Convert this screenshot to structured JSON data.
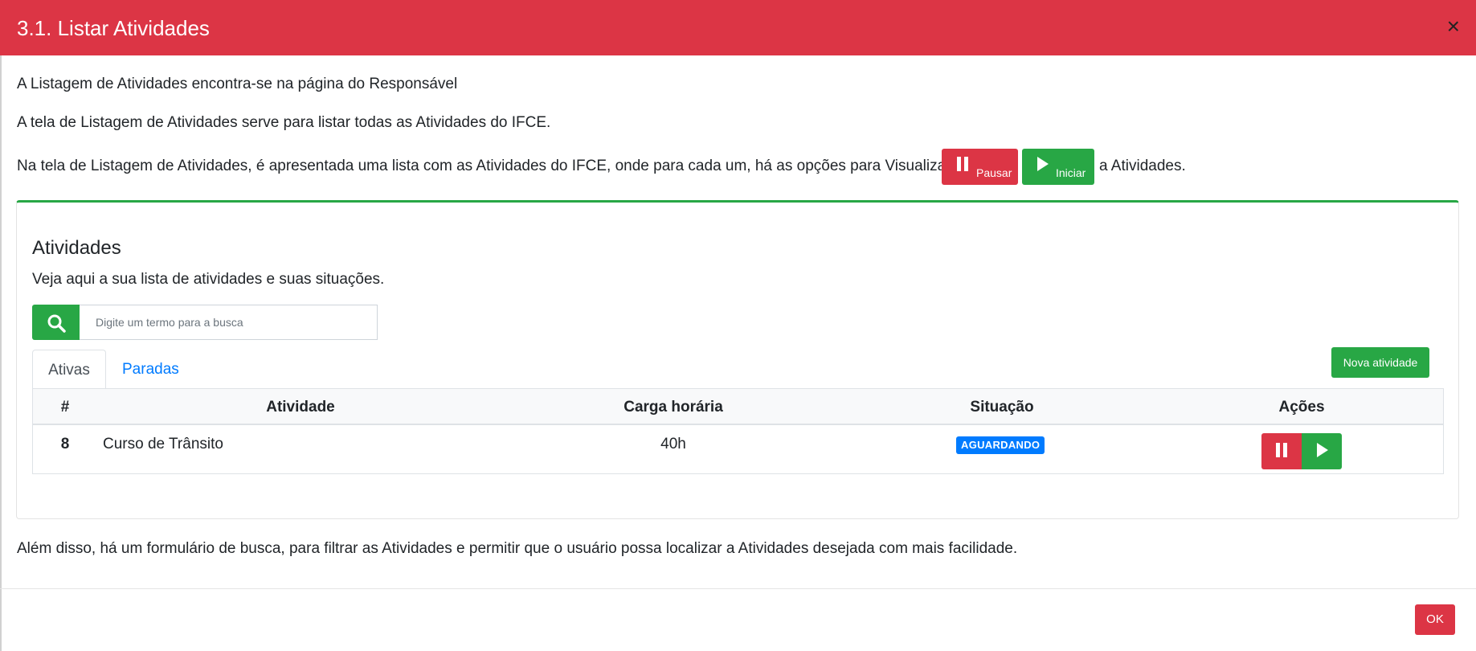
{
  "modal": {
    "title": "3.1. Listar Atividades",
    "close_symbol": "×",
    "paragraphs": {
      "p1": "A Listagem de Atividades encontra-se na página do Responsável",
      "p2": "A tela de Listagem de Atividades serve para listar todas as Atividades do IFCE.",
      "p3_before": "Na tela de Listagem de Atividades, é apresentada uma lista com as Atividades do IFCE, onde para cada um, há as opções para Visualizar",
      "p3_after": "a Atividades.",
      "p4": "Além disso, há um formulário de busca, para filtrar as Atividades e permitir que o usuário possa localizar a Atividades desejada com mais facilidade."
    },
    "inline_buttons": {
      "pause_label": "Pausar",
      "start_label": "Iniciar"
    },
    "ok_label": "OK"
  },
  "card": {
    "title": "Atividades",
    "subtitle": "Veja aqui a sua lista de atividades e suas situações.",
    "search": {
      "placeholder": "Digite um termo para a busca",
      "icon": "search-icon"
    },
    "tabs": [
      "Ativas",
      "Paradas"
    ],
    "new_button": "Nova atividade",
    "table": {
      "headers": [
        "#",
        "Atividade",
        "Carga horária",
        "Situação",
        "Ações"
      ],
      "rows": [
        {
          "id": "8",
          "name": "Curso de Trânsito",
          "hours": "40h",
          "status": "AGUARDANDO"
        }
      ]
    }
  },
  "colors": {
    "danger": "#dc3545",
    "success": "#28a745",
    "primary": "#007bff"
  }
}
